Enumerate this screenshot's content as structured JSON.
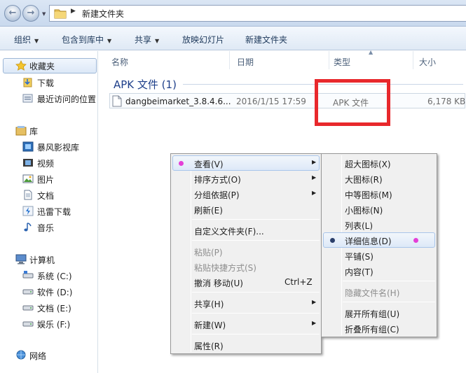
{
  "address": {
    "path": "新建文件夹"
  },
  "toolbar": {
    "organize": "组织",
    "include_in_library": "包含到库中",
    "share": "共享",
    "slideshow": "放映幻灯片",
    "new_folder": "新建文件夹"
  },
  "sidebar": {
    "favorites": "收藏夹",
    "downloads": "下载",
    "recent": "最近访问的位置",
    "libraries": "库",
    "storm": "暴风影视库",
    "videos": "视频",
    "pictures": "图片",
    "documents": "文档",
    "thunder": "迅雷下载",
    "music": "音乐",
    "computer": "计算机",
    "drive_c": "系统 (C:)",
    "drive_d": "软件 (D:)",
    "drive_e": "文档 (E:)",
    "drive_f": "娱乐 (F:)",
    "network": "网络"
  },
  "columns": {
    "name": "名称",
    "date": "日期",
    "type": "类型",
    "size": "大小"
  },
  "group": {
    "title": "APK 文件 (1)"
  },
  "file": {
    "name": "dangbeimarket_3.8.4.6...",
    "date": "2016/1/15 17:59",
    "type": "APK 文件",
    "size": "6,178 KB"
  },
  "context_menu": {
    "view": "查看(V)",
    "sort": "排序方式(O)",
    "group_by": "分组依据(P)",
    "refresh": "刷新(E)",
    "customize": "自定义文件夹(F)...",
    "paste": "粘贴(P)",
    "paste_shortcut": "粘贴快捷方式(S)",
    "undo_move": "撤消 移动(U)",
    "undo_shortcut": "Ctrl+Z",
    "share": "共享(H)",
    "new": "新建(W)",
    "properties": "属性(R)"
  },
  "view_submenu": {
    "extra_large": "超大图标(X)",
    "large": "大图标(R)",
    "medium": "中等图标(M)",
    "small": "小图标(N)",
    "list": "列表(L)",
    "details": "详细信息(D)",
    "tiles": "平铺(S)",
    "content": "内容(T)",
    "hide_names": "隐藏文件名(H)",
    "expand_groups": "展开所有组(U)",
    "collapse_groups": "折叠所有组(C)"
  },
  "colors": {
    "highlight_mark": "#e43fd7",
    "annotation_box": "#e8282c",
    "group_title": "#1e3f8a"
  }
}
